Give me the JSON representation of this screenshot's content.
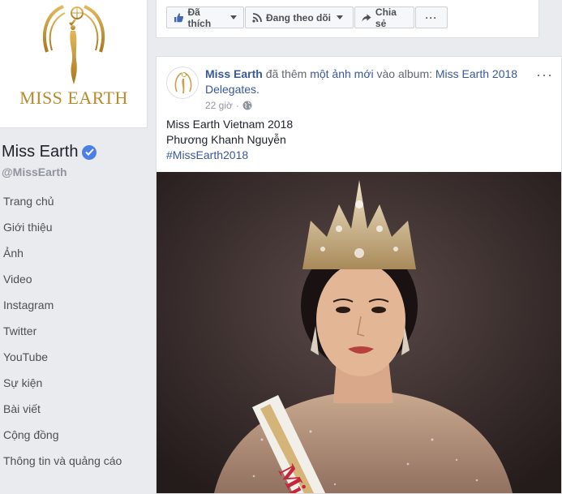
{
  "sidebar": {
    "logo_text": "MISS EARTH",
    "page_name": "Miss Earth",
    "handle": "@MissEarth",
    "items": [
      {
        "label": "Trang chủ"
      },
      {
        "label": "Giới thiệu"
      },
      {
        "label": "Ảnh"
      },
      {
        "label": "Video"
      },
      {
        "label": "Instagram"
      },
      {
        "label": "Twitter"
      },
      {
        "label": "YouTube"
      },
      {
        "label": "Sự kiện"
      },
      {
        "label": "Bài viết"
      },
      {
        "label": "Cộng đồng"
      },
      {
        "label": "Thông tin và quảng cáo"
      }
    ]
  },
  "actions": {
    "liked_label": "Đã thích",
    "following_label": "Đang theo dõi",
    "share_label": "Chia sẻ",
    "more_label": "···"
  },
  "post": {
    "author": "Miss Earth",
    "action_text": "đã thêm",
    "action_link": "một ảnh mới",
    "album_text": "vào album:",
    "album_name": "Miss Earth 2018 Delegates.",
    "time": "22 giờ",
    "more_label": "···",
    "text_line1": "Miss Earth Vietnam 2018",
    "text_line2": "Phương Khanh Nguyễn",
    "hashtag": "#MissEarth2018",
    "sash_text": "Miss"
  },
  "colors": {
    "link": "#385898",
    "gold": "#b88a2b",
    "verified": "#4c7ee8"
  }
}
